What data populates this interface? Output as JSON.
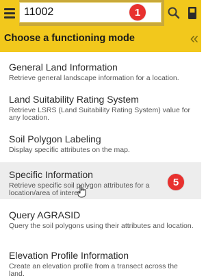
{
  "search": {
    "value": "11002"
  },
  "badges": {
    "step1": "1",
    "step5": "5"
  },
  "header": {
    "title": "Choose a functioning mode",
    "collapse_icon": "«"
  },
  "items": [
    {
      "title": "General Land Information",
      "desc": "Retrieve general landscape information for a location."
    },
    {
      "title": "Land Suitability Rating System",
      "desc": "Retrieve LSRS (Land Suitability Rating System) value for any location."
    },
    {
      "title": "Soil Polygon Labeling",
      "desc": "Display specific attributes on the map."
    },
    {
      "title": "Specific Information",
      "desc": "Retrieve specific soil polygon attributes for a location/area of interest."
    },
    {
      "title": "Query AGRASID",
      "desc": "Query the soil polygons using their attributes and location."
    },
    {
      "title": "Elevation Profile Information",
      "desc": "Create an elevation profile from a transect across the land."
    }
  ],
  "colors": {
    "accent": "#f2c81c",
    "badge": "#e8312f",
    "active_row": "#ededed"
  },
  "icons": [
    "hamburger-menu-icon",
    "search-icon",
    "book-icon",
    "double-chevron-left-icon",
    "hand-pointer-icon"
  ]
}
